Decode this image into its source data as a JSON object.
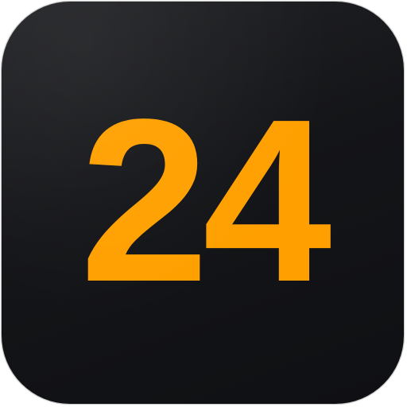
{
  "icon": {
    "number": "24",
    "colors": {
      "background": "#131417",
      "number": "#ffa000"
    }
  }
}
